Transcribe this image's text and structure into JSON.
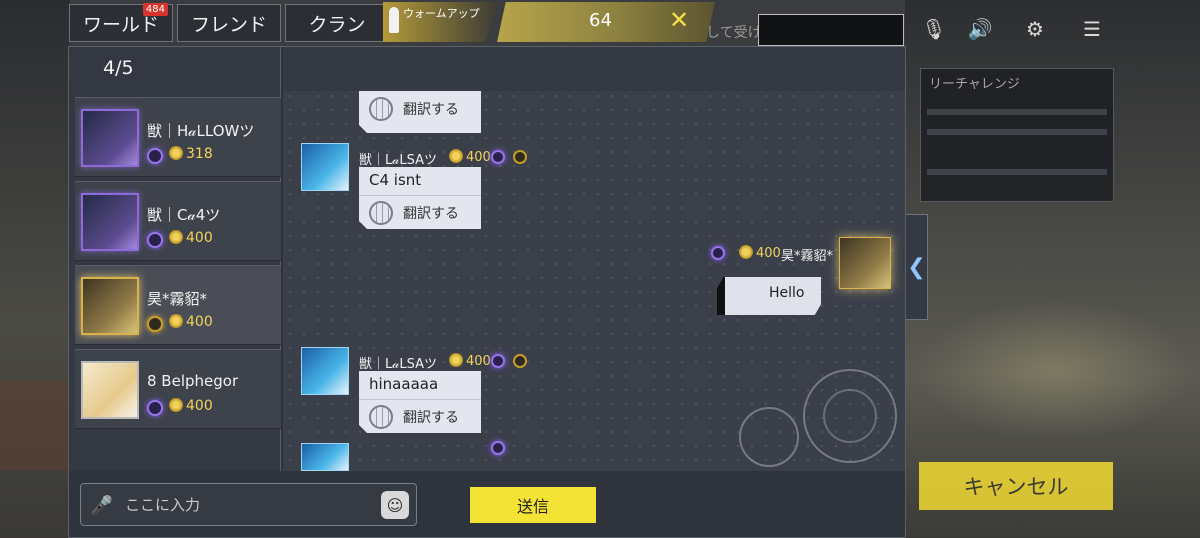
{
  "tabs": {
    "world_label": "ワールド",
    "world_badge": "484",
    "friend_label": "フレンド",
    "clan_label": "クラン",
    "warmup_label": "ウォームアップ",
    "score": "64"
  },
  "background": {
    "partial_text": "して受け",
    "challenge_title": "リーチャレンジ",
    "cancel_label": "キャンセル"
  },
  "list": {
    "count": "4/5",
    "friends": [
      {
        "name": "獣｜H𝒶LLOWツ",
        "score": "318"
      },
      {
        "name": "獣｜C𝒶4ツ",
        "score": "400"
      },
      {
        "name": "昊*霧貂*",
        "score": "400"
      },
      {
        "name": "8 Belphegor",
        "score": "400"
      }
    ]
  },
  "chat": {
    "translate_label": "翻訳する",
    "messages": [
      {
        "name": "獣｜L𝒶LSAツ",
        "score": "400",
        "text": "C4 isnt"
      },
      {
        "name": "昊*霧貂*",
        "score": "400",
        "text": "Hello"
      },
      {
        "name": "獣｜L𝒶LSAツ",
        "score": "400",
        "text": "hinaaaaa"
      }
    ]
  },
  "input": {
    "placeholder": "ここに入力",
    "send_label": "送信"
  },
  "icons": {
    "close": "close-icon",
    "mic": "microphone-icon",
    "emoji": "emoji-icon",
    "collapse": "chevron-left-icon",
    "sound": "speaker-icon",
    "menu": "menu-icon"
  },
  "colors": {
    "accent_yellow": "#f3e334",
    "score_gold": "#f3d35a",
    "badge_red": "#d9342b",
    "panel": "#2f333c"
  }
}
